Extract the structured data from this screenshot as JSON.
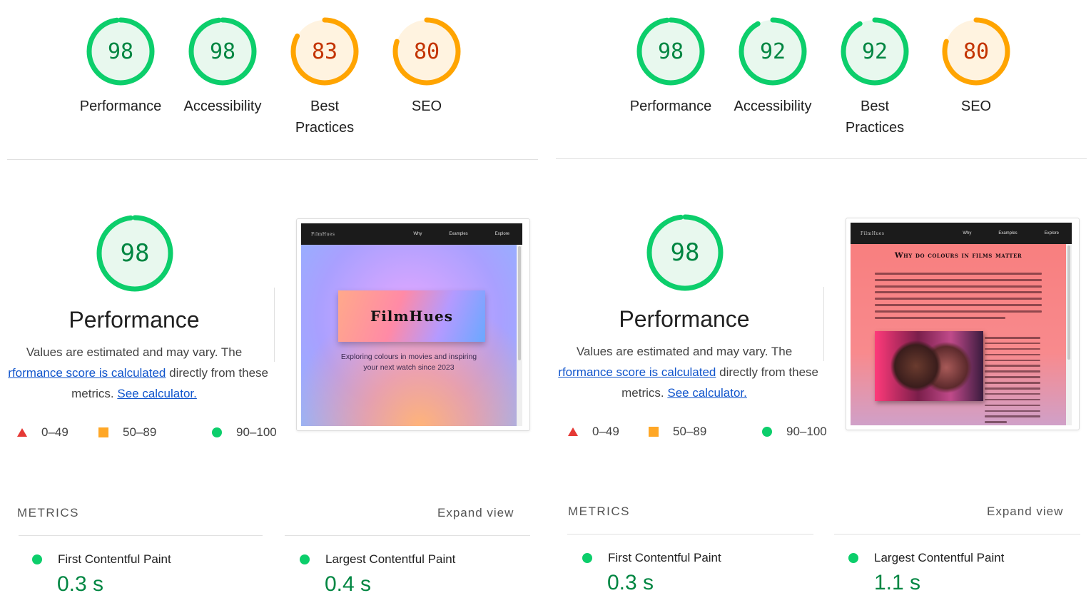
{
  "colors": {
    "pass": "#0cce6b",
    "pass_text": "#018642",
    "average": "#ffa400",
    "average_text": "#c33300",
    "link": "#1155cc"
  },
  "reports": [
    {
      "categories": [
        {
          "score": "98",
          "label": "Performance",
          "level": "pass"
        },
        {
          "score": "98",
          "label": "Accessibility",
          "level": "pass"
        },
        {
          "score": "83",
          "label": "Best Practices",
          "label_line1": "Best",
          "label_line2": "Practices",
          "level": "average"
        },
        {
          "score": "80",
          "label": "SEO",
          "level": "average"
        }
      ],
      "performance": {
        "score": "98",
        "title": "Performance",
        "desc_line1": "Values are estimated and may vary. The",
        "desc_link1": "rformance score is calculated",
        "desc_line2_rest": " directly from these",
        "desc_line3_pre": "metrics. ",
        "desc_link2": "See calculator.",
        "legend": {
          "fail": "0–49",
          "average": "50–89",
          "pass": "90–100"
        }
      },
      "thumbnail": {
        "brand": "FilmHues",
        "nav": [
          "Why",
          "Examples",
          "Explore"
        ],
        "hero": "FilmHues",
        "subtitle_line1": "Exploring colours in movies and inspiring",
        "subtitle_line2": "your next watch since 2023"
      },
      "metrics": {
        "heading": "METRICS",
        "expand": "Expand view",
        "items": [
          {
            "name": "First Contentful Paint",
            "value": "0.3 s"
          },
          {
            "name": "Largest Contentful Paint",
            "value": "0.4 s"
          }
        ]
      }
    },
    {
      "categories": [
        {
          "score": "98",
          "label": "Performance",
          "level": "pass"
        },
        {
          "score": "92",
          "label": "Accessibility",
          "level": "pass"
        },
        {
          "score": "92",
          "label": "Best Practices",
          "label_line1": "Best",
          "label_line2": "Practices",
          "level": "pass"
        },
        {
          "score": "80",
          "label": "SEO",
          "level": "average"
        }
      ],
      "performance": {
        "score": "98",
        "title": "Performance",
        "desc_line1": "Values are estimated and may vary. The",
        "desc_link1": "rformance score is calculated",
        "desc_line2_rest": " directly from these",
        "desc_line3_pre": "metrics. ",
        "desc_link2": "See calculator.",
        "legend": {
          "fail": "0–49",
          "average": "50–89",
          "pass": "90–100"
        }
      },
      "thumbnail": {
        "brand": "FilmHues",
        "nav": [
          "Why",
          "Examples",
          "Explore"
        ],
        "heading": "Why do colours in films matter"
      },
      "metrics": {
        "heading": "METRICS",
        "expand": "Expand view",
        "items": [
          {
            "name": "First Contentful Paint",
            "value": "0.3 s"
          },
          {
            "name": "Largest Contentful Paint",
            "value": "1.1 s"
          }
        ]
      }
    }
  ]
}
